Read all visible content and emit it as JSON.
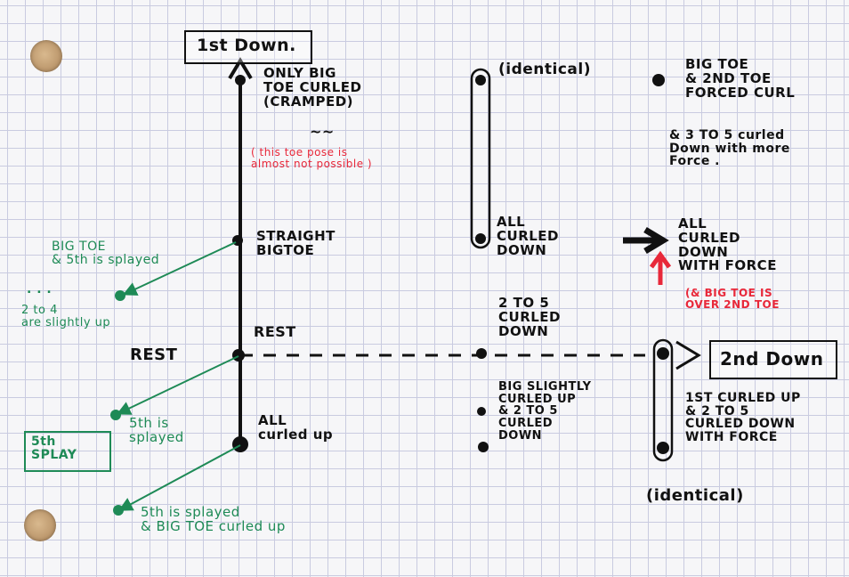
{
  "header": {
    "first_pos": "1st Down.",
    "second_pos": "2nd Down"
  },
  "left_column": {
    "top_label": "ONLY BIG\nTOE CURLED\n(CRAMPED)",
    "top_tilde": "~~",
    "red_note": "( this toe pose is\nalmost not possible )",
    "straight": "STRAIGHT\nBIGTOE",
    "rest_mark": "REST",
    "rest_axis": "REST",
    "bottom": "ALL\ncurled up"
  },
  "green_notes": {
    "bigtoe_splay": "BIG TOE\n& 5th is splayed",
    "dots": ". . .",
    "two_to_four": "2 to 4\nare slightly up",
    "fifth_splayed_1": "5th is\nsplayed",
    "fifth_splay_box": "5th\nSPLAY",
    "fifth_splayed_2": "5th is splayed\n& BIG TOE curled up"
  },
  "middle_column": {
    "identical": "(identical)",
    "all_curled_down": "ALL\nCURLED\nDOWN",
    "two_to_five": "2 TO 5\nCURLED\nDOWN",
    "big_slightly": "BIG SLIGHTLY\nCURLED UP\n& 2 TO 5\nCURLED\nDOWN"
  },
  "right_column": {
    "forced_curl": "BIG TOE\n& 2nd TOE\nFORCED CURL",
    "three_to_five": "& 3 TO 5 curled\nDown with more\nForce .",
    "all_curled_force": "ALL\nCURLED\nDOWN\nWITH FORCE",
    "red_note": "(& BIG TOE is\nover 2nd TOE",
    "first_curled": "1st CURLED UP\n& 2 TO 5\nCURLED DOWN\nWITH FORCE",
    "identical": "(identical)"
  },
  "colors": {
    "ink": "#111111",
    "green": "#1e8a56",
    "red": "#e8283a",
    "grid": "#c9cbe0"
  }
}
